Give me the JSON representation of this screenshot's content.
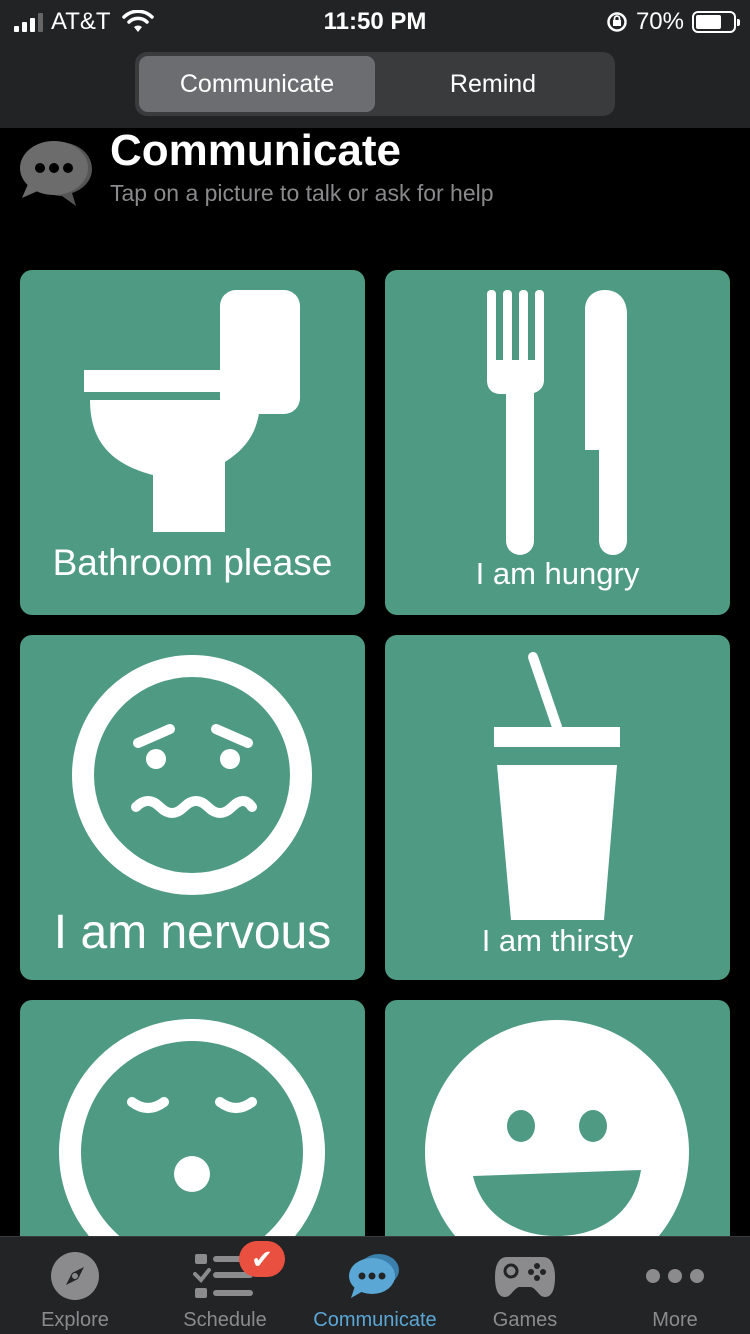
{
  "status_bar": {
    "carrier": "AT&T",
    "time": "11:50 PM",
    "battery": "70%",
    "battery_level": 0.7
  },
  "segmented": {
    "options": [
      "Communicate",
      "Remind"
    ],
    "selected": "Communicate"
  },
  "header": {
    "icon": "chat-bubbles-icon",
    "title": "Communicate",
    "subtitle": "Tap on a picture to talk or ask for help"
  },
  "cards": [
    {
      "label": "Bathroom please",
      "icon": "toilet-icon"
    },
    {
      "label": "I am hungry",
      "icon": "fork-knife-icon"
    },
    {
      "label": "I am nervous",
      "icon": "nervous-face-icon"
    },
    {
      "label": "I am thirsty",
      "icon": "cup-straw-icon"
    },
    {
      "label": "",
      "icon": "sleepy-face-icon"
    },
    {
      "label": "",
      "icon": "happy-face-icon"
    }
  ],
  "tabbar": {
    "items": [
      {
        "label": "Explore",
        "icon": "compass-icon"
      },
      {
        "label": "Schedule",
        "icon": "checklist-icon",
        "badge": "✔"
      },
      {
        "label": "Communicate",
        "icon": "chat-bubbles-icon",
        "active": true
      },
      {
        "label": "Games",
        "icon": "gamepad-icon"
      },
      {
        "label": "More",
        "icon": "more-dots-icon"
      }
    ]
  },
  "colors": {
    "card": "#4f9a82",
    "active_tab": "#5aa7d6",
    "badge": "#e9503f"
  }
}
